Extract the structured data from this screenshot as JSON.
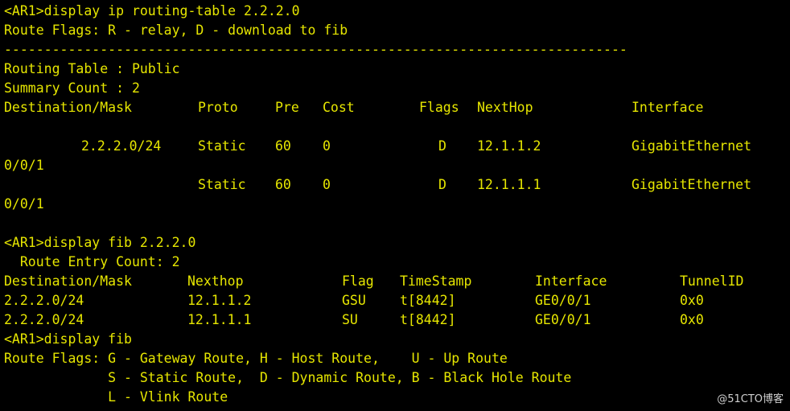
{
  "colors": {
    "background": "#000000",
    "text": "#e6e600",
    "watermark": "#d0d0d0"
  },
  "lines": {
    "cmd1": "<AR1>display ip routing-table 2.2.2.0",
    "flags1": "Route Flags: R - relay, D - download to fib",
    "separator": "------------------------------------------------------------------------------",
    "routing_table": "Routing Table : Public",
    "summary": "Summary Count : 2",
    "rt_header": {
      "dest": "Destination/Mask",
      "proto": "Proto",
      "pre": "Pre",
      "cost": "Cost",
      "flags": "Flags",
      "nexthop": "NextHop",
      "interface": "Interface"
    },
    "rt_rows": [
      {
        "dest": "2.2.2.0/24",
        "proto": "Static",
        "pre": "60",
        "cost": "0",
        "flags": "D",
        "nexthop": "12.1.1.2",
        "interface": "GigabitEthernet",
        "interface_cont": "0/0/1"
      },
      {
        "dest": "",
        "proto": "Static",
        "pre": "60",
        "cost": "0",
        "flags": "D",
        "nexthop": "12.1.1.1",
        "interface": "GigabitEthernet",
        "interface_cont": "0/0/1"
      }
    ],
    "cmd2": "<AR1>display fib 2.2.2.0",
    "route_entry": "  Route Entry Count: 2",
    "fib_header": {
      "dest": "Destination/Mask",
      "nexthop": "Nexthop",
      "flag": "Flag",
      "timestamp": "TimeStamp",
      "interface": "Interface",
      "tunnel": "TunnelID"
    },
    "fib_rows": [
      {
        "dest": "2.2.2.0/24",
        "nexthop": "12.1.1.2",
        "flag": "GSU",
        "timestamp": "t[8442]",
        "interface": "GE0/0/1",
        "tunnel": "0x0"
      },
      {
        "dest": "2.2.2.0/24",
        "nexthop": "12.1.1.1",
        "flag": "SU",
        "timestamp": "t[8442]",
        "interface": "GE0/0/1",
        "tunnel": "0x0"
      }
    ],
    "cmd3": "<AR1>display fib",
    "flags2_a": "Route Flags: G - Gateway Route, H - Host Route,    U - Up Route",
    "flags2_b": "             S - Static Route,  D - Dynamic Route, B - Black Hole Route",
    "flags2_c": "             L - Vlink Route"
  },
  "watermark": "@51CTO博客"
}
